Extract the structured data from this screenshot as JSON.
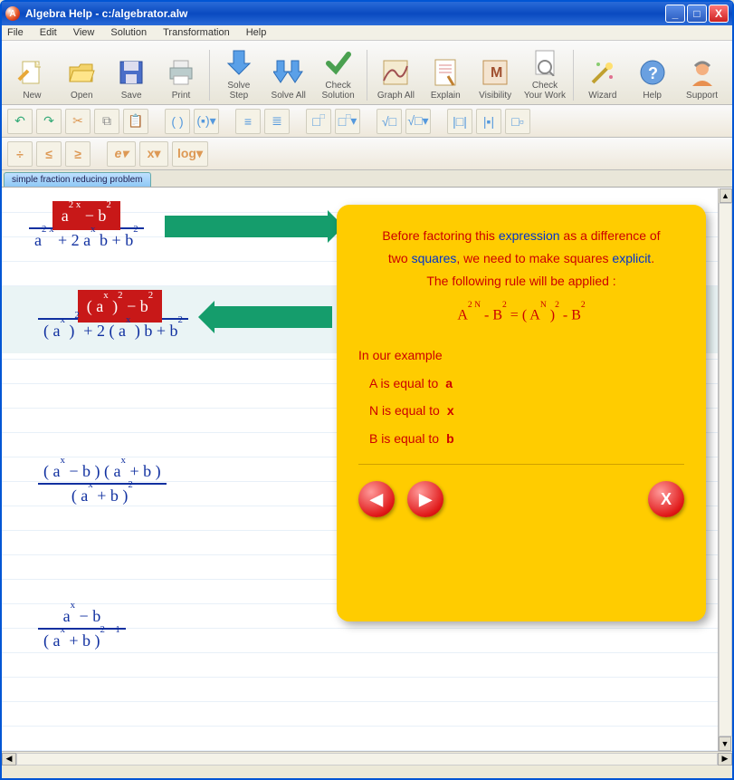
{
  "title": "Algebra Help  - c:/algebrator.alw",
  "menu": [
    "File",
    "Edit",
    "View",
    "Solution",
    "Transformation",
    "Help"
  ],
  "toolbar": [
    {
      "id": "new",
      "label": "New"
    },
    {
      "id": "open",
      "label": "Open"
    },
    {
      "id": "save",
      "label": "Save"
    },
    {
      "id": "print",
      "label": "Print"
    },
    {
      "id": "solve-step",
      "label": "Solve\nStep"
    },
    {
      "id": "solve-all",
      "label": "Solve All"
    },
    {
      "id": "check-solution",
      "label": "Check\nSolution"
    },
    {
      "id": "graph-all",
      "label": "Graph All"
    },
    {
      "id": "explain",
      "label": "Explain"
    },
    {
      "id": "visibility",
      "label": "Visibility"
    },
    {
      "id": "check-work",
      "label": "Check\nYour Work"
    },
    {
      "id": "wizard",
      "label": "Wizard"
    },
    {
      "id": "help",
      "label": "Help"
    },
    {
      "id": "support",
      "label": "Support"
    }
  ],
  "tab": "simple fraction reducing problem",
  "explain": {
    "line1a": "Before factoring this ",
    "line1b": "expression",
    "line1c": " as a difference of",
    "line2a": "two ",
    "line2b": "squares",
    "line2c": ", we need to make squares ",
    "line2d": "explicit",
    "line2e": ".",
    "line3": "The following rule will be applied :",
    "rule": "A 2 N - B 2 = ( A N ) 2 - B 2",
    "ex_hdr": "In our example",
    "a_lab": "A is equal to",
    "a_val": "a",
    "n_lab": "N is equal to",
    "n_val": "x",
    "b_lab": "B is equal to",
    "b_val": "b"
  },
  "steps": {
    "s1_num": "a 2 x − b 2",
    "s1_den": "a 2 x + 2 a x b + b 2",
    "s2_num": "( a x ) 2 − b 2",
    "s2_den": "( a x ) 2 + 2 ( a x ) b + b 2",
    "s3_num": "( a x − b ) ( a x + b )",
    "s3_den": "( a x + b ) 2",
    "s4_num": "a x − b",
    "s4_den": "( a x + b ) 2 − 1"
  }
}
